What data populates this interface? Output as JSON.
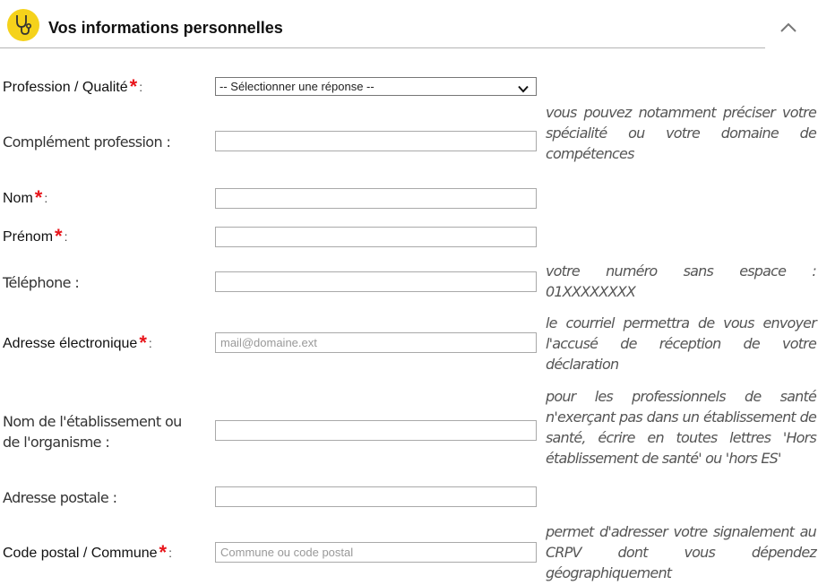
{
  "header": {
    "title": "Vos informations personnelles",
    "icon": "stethoscope-icon",
    "toggle_icon": "chevron-up-icon",
    "accent_color": "#f5d21b"
  },
  "required_marker": "*",
  "fields": {
    "profession": {
      "label": "Profession / Qualité",
      "colon": ":",
      "value": "-- Sélectionner une réponse --"
    },
    "complement": {
      "label": "Complément profession :",
      "value": "",
      "help": "vous pouvez notamment préciser votre spécialité ou votre domaine de compétences"
    },
    "nom": {
      "label": "Nom",
      "colon": ":",
      "value": ""
    },
    "prenom": {
      "label": "Prénom",
      "colon": ":",
      "value": ""
    },
    "telephone": {
      "label": "Téléphone :",
      "value": "",
      "help": "votre numéro sans espace : 01XXXXXXXX"
    },
    "email": {
      "label": "Adresse électronique",
      "colon": ":",
      "placeholder": "mail@domaine.ext",
      "help": "le courriel permettra de vous envoyer l'accusé de réception de votre déclaration"
    },
    "etablissement": {
      "label_line1": "Nom de l'établissement ou",
      "label_line2": "de l'organisme :",
      "value": "",
      "help": "pour les professionnels de santé n'exerçant pas dans un établissement de santé, écrire en toutes lettres 'Hors établissement de santé' ou 'hors ES'"
    },
    "adresse": {
      "label": "Adresse postale :",
      "value": ""
    },
    "code_postal": {
      "label": "Code postal / Commune",
      "colon": ":",
      "placeholder": "Commune ou code postal",
      "help": "permet d'adresser votre signalement au CRPV dont vous dépendez géographiquement"
    }
  }
}
